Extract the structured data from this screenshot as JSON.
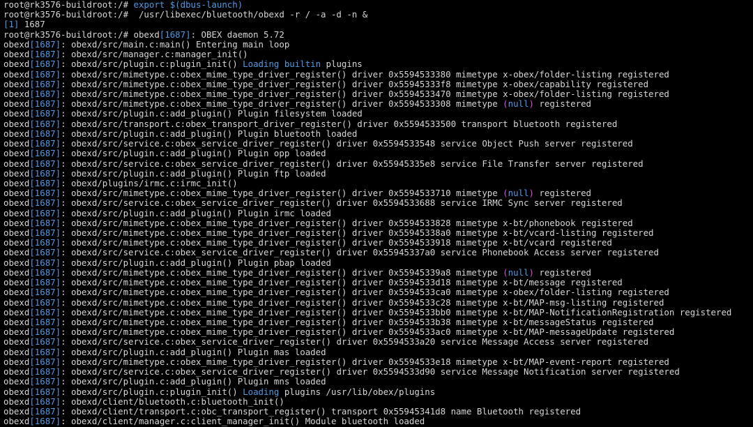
{
  "colors": {
    "background": "#000000",
    "text": "#d6d6d6",
    "highlight_blue": "#4e9be6",
    "highlight_magenta": "#d64bd6"
  },
  "terminal": {
    "lines": [
      [
        {
          "t": "root@rk3576-buildroot:/# "
        },
        {
          "t": "export $(dbus-launch)",
          "c": "b"
        }
      ],
      [
        {
          "t": "root@rk3576-buildroot:/#  /usr/libexec/bluetooth/obexd -r / -a -d -n &"
        }
      ],
      [
        {
          "t": "[1]",
          "c": "b"
        },
        {
          "t": " 1687"
        }
      ],
      [
        {
          "t": "root@rk3576-buildroot:/# obexd"
        },
        {
          "t": "[1687]",
          "c": "b"
        },
        {
          "t": ": OBEX daemon 5.72"
        }
      ],
      [
        {
          "t": "obexd"
        },
        {
          "t": "[1687]",
          "c": "b"
        },
        {
          "t": ": obexd/src/main.c:main() Entering main loop"
        }
      ],
      [
        {
          "t": "obexd"
        },
        {
          "t": "[1687]",
          "c": "b"
        },
        {
          "t": ": obexd/src/manager.c:manager_init()"
        }
      ],
      [
        {
          "t": "obexd"
        },
        {
          "t": "[1687]",
          "c": "b"
        },
        {
          "t": ": obexd/src/plugin.c:plugin_init() "
        },
        {
          "t": "Loading builtin",
          "c": "b"
        },
        {
          "t": " plugins"
        }
      ],
      [
        {
          "t": "obexd"
        },
        {
          "t": "[1687]",
          "c": "b"
        },
        {
          "t": ": obexd/src/mimetype.c:obex_mime_type_driver_register() driver 0x5594533380 mimetype x-obex/folder-listing registered"
        }
      ],
      [
        {
          "t": "obexd"
        },
        {
          "t": "[1687]",
          "c": "b"
        },
        {
          "t": ": obexd/src/mimetype.c:obex_mime_type_driver_register() driver 0x55945333f8 mimetype x-obex/capability registered"
        }
      ],
      [
        {
          "t": "obexd"
        },
        {
          "t": "[1687]",
          "c": "b"
        },
        {
          "t": ": obexd/src/mimetype.c:obex_mime_type_driver_register() driver 0x5594533470 mimetype x-obex/folder-listing registered"
        }
      ],
      [
        {
          "t": "obexd"
        },
        {
          "t": "[1687]",
          "c": "b"
        },
        {
          "t": ": obexd/src/mimetype.c:obex_mime_type_driver_register() driver 0x5594533308 mimetype "
        },
        {
          "t": "(",
          "c": "m"
        },
        {
          "t": "null",
          "c": "b"
        },
        {
          "t": ")",
          "c": "m"
        },
        {
          "t": " registered"
        }
      ],
      [
        {
          "t": "obexd"
        },
        {
          "t": "[1687]",
          "c": "b"
        },
        {
          "t": ": obexd/src/plugin.c:add_plugin() Plugin filesystem loaded"
        }
      ],
      [
        {
          "t": "obexd"
        },
        {
          "t": "[1687]",
          "c": "b"
        },
        {
          "t": ": obexd/src/transport.c:obex_transport_driver_register() driver 0x5594533500 transport bluetooth registered"
        }
      ],
      [
        {
          "t": "obexd"
        },
        {
          "t": "[1687]",
          "c": "b"
        },
        {
          "t": ": obexd/src/plugin.c:add_plugin() Plugin bluetooth loaded"
        }
      ],
      [
        {
          "t": "obexd"
        },
        {
          "t": "[1687]",
          "c": "b"
        },
        {
          "t": ": obexd/src/service.c:obex_service_driver_register() driver 0x5594533548 service Object Push server registered"
        }
      ],
      [
        {
          "t": "obexd"
        },
        {
          "t": "[1687]",
          "c": "b"
        },
        {
          "t": ": obexd/src/plugin.c:add_plugin() Plugin opp loaded"
        }
      ],
      [
        {
          "t": "obexd"
        },
        {
          "t": "[1687]",
          "c": "b"
        },
        {
          "t": ": obexd/src/service.c:obex_service_driver_register() driver 0x55945335e8 service File Transfer server registered"
        }
      ],
      [
        {
          "t": "obexd"
        },
        {
          "t": "[1687]",
          "c": "b"
        },
        {
          "t": ": obexd/src/plugin.c:add_plugin() Plugin ftp loaded"
        }
      ],
      [
        {
          "t": "obexd"
        },
        {
          "t": "[1687]",
          "c": "b"
        },
        {
          "t": ": obexd/plugins/irmc.c:irmc_init()"
        }
      ],
      [
        {
          "t": "obexd"
        },
        {
          "t": "[1687]",
          "c": "b"
        },
        {
          "t": ": obexd/src/mimetype.c:obex_mime_type_driver_register() driver 0x5594533710 mimetype "
        },
        {
          "t": "(",
          "c": "m"
        },
        {
          "t": "null",
          "c": "b"
        },
        {
          "t": ")",
          "c": "m"
        },
        {
          "t": " registered"
        }
      ],
      [
        {
          "t": "obexd"
        },
        {
          "t": "[1687]",
          "c": "b"
        },
        {
          "t": ": obexd/src/service.c:obex_service_driver_register() driver 0x5594533688 service IRMC Sync server registered"
        }
      ],
      [
        {
          "t": "obexd"
        },
        {
          "t": "[1687]",
          "c": "b"
        },
        {
          "t": ": obexd/src/plugin.c:add_plugin() Plugin irmc loaded"
        }
      ],
      [
        {
          "t": "obexd"
        },
        {
          "t": "[1687]",
          "c": "b"
        },
        {
          "t": ": obexd/src/mimetype.c:obex_mime_type_driver_register() driver 0x5594533828 mimetype x-bt/phonebook registered"
        }
      ],
      [
        {
          "t": "obexd"
        },
        {
          "t": "[1687]",
          "c": "b"
        },
        {
          "t": ": obexd/src/mimetype.c:obex_mime_type_driver_register() driver 0x55945338a0 mimetype x-bt/vcard-listing registered"
        }
      ],
      [
        {
          "t": "obexd"
        },
        {
          "t": "[1687]",
          "c": "b"
        },
        {
          "t": ": obexd/src/mimetype.c:obex_mime_type_driver_register() driver 0x5594533918 mimetype x-bt/vcard registered"
        }
      ],
      [
        {
          "t": "obexd"
        },
        {
          "t": "[1687]",
          "c": "b"
        },
        {
          "t": ": obexd/src/service.c:obex_service_driver_register() driver 0x55945337a0 service Phonebook Access server registered"
        }
      ],
      [
        {
          "t": "obexd"
        },
        {
          "t": "[1687]",
          "c": "b"
        },
        {
          "t": ": obexd/src/plugin.c:add_plugin() Plugin pbap loaded"
        }
      ],
      [
        {
          "t": "obexd"
        },
        {
          "t": "[1687]",
          "c": "b"
        },
        {
          "t": ": obexd/src/mimetype.c:obex_mime_type_driver_register() driver 0x55945339a8 mimetype "
        },
        {
          "t": "(",
          "c": "m"
        },
        {
          "t": "null",
          "c": "b"
        },
        {
          "t": ")",
          "c": "m"
        },
        {
          "t": " registered"
        }
      ],
      [
        {
          "t": "obexd"
        },
        {
          "t": "[1687]",
          "c": "b"
        },
        {
          "t": ": obexd/src/mimetype.c:obex_mime_type_driver_register() driver 0x5594533d18 mimetype x-bt/message registered"
        }
      ],
      [
        {
          "t": "obexd"
        },
        {
          "t": "[1687]",
          "c": "b"
        },
        {
          "t": ": obexd/src/mimetype.c:obex_mime_type_driver_register() driver 0x5594533ca0 mimetype x-obex/folder-listing registered"
        }
      ],
      [
        {
          "t": "obexd"
        },
        {
          "t": "[1687]",
          "c": "b"
        },
        {
          "t": ": obexd/src/mimetype.c:obex_mime_type_driver_register() driver 0x5594533c28 mimetype x-bt/MAP-msg-listing registered"
        }
      ],
      [
        {
          "t": "obexd"
        },
        {
          "t": "[1687]",
          "c": "b"
        },
        {
          "t": ": obexd/src/mimetype.c:obex_mime_type_driver_register() driver 0x5594533bb0 mimetype x-bt/MAP-NotificationRegistration registered"
        }
      ],
      [
        {
          "t": "obexd"
        },
        {
          "t": "[1687]",
          "c": "b"
        },
        {
          "t": ": obexd/src/mimetype.c:obex_mime_type_driver_register() driver 0x5594533b38 mimetype x-bt/messageStatus registered"
        }
      ],
      [
        {
          "t": "obexd"
        },
        {
          "t": "[1687]",
          "c": "b"
        },
        {
          "t": ": obexd/src/mimetype.c:obex_mime_type_driver_register() driver 0x5594533ac0 mimetype x-bt/MAP-messageUpdate registered"
        }
      ],
      [
        {
          "t": "obexd"
        },
        {
          "t": "[1687]",
          "c": "b"
        },
        {
          "t": ": obexd/src/service.c:obex_service_driver_register() driver 0x5594533a20 service Message Access server registered"
        }
      ],
      [
        {
          "t": "obexd"
        },
        {
          "t": "[1687]",
          "c": "b"
        },
        {
          "t": ": obexd/src/plugin.c:add_plugin() Plugin mas loaded"
        }
      ],
      [
        {
          "t": "obexd"
        },
        {
          "t": "[1687]",
          "c": "b"
        },
        {
          "t": ": obexd/src/mimetype.c:obex_mime_type_driver_register() driver 0x5594533e18 mimetype x-bt/MAP-event-report registered"
        }
      ],
      [
        {
          "t": "obexd"
        },
        {
          "t": "[1687]",
          "c": "b"
        },
        {
          "t": ": obexd/src/service.c:obex_service_driver_register() driver 0x5594533d90 service Message Notification server registered"
        }
      ],
      [
        {
          "t": "obexd"
        },
        {
          "t": "[1687]",
          "c": "b"
        },
        {
          "t": ": obexd/src/plugin.c:add_plugin() Plugin mns loaded"
        }
      ],
      [
        {
          "t": "obexd"
        },
        {
          "t": "[1687]",
          "c": "b"
        },
        {
          "t": ": obexd/src/plugin.c:plugin_init() "
        },
        {
          "t": "Loading",
          "c": "b"
        },
        {
          "t": " plugins /usr/lib/obex/plugins"
        }
      ],
      [
        {
          "t": "obexd"
        },
        {
          "t": "[1687]",
          "c": "b"
        },
        {
          "t": ": obexd/client/bluetooth.c:bluetooth_init()"
        }
      ],
      [
        {
          "t": "obexd"
        },
        {
          "t": "[1687]",
          "c": "b"
        },
        {
          "t": ": obexd/client/transport.c:obc_transport_register() transport 0x55945341d8 name Bluetooth registered"
        }
      ],
      [
        {
          "t": "obexd"
        },
        {
          "t": "[1687]",
          "c": "b"
        },
        {
          "t": ": obexd/client/manager.c:client_manager_init() Module bluetooth loaded"
        }
      ]
    ]
  }
}
